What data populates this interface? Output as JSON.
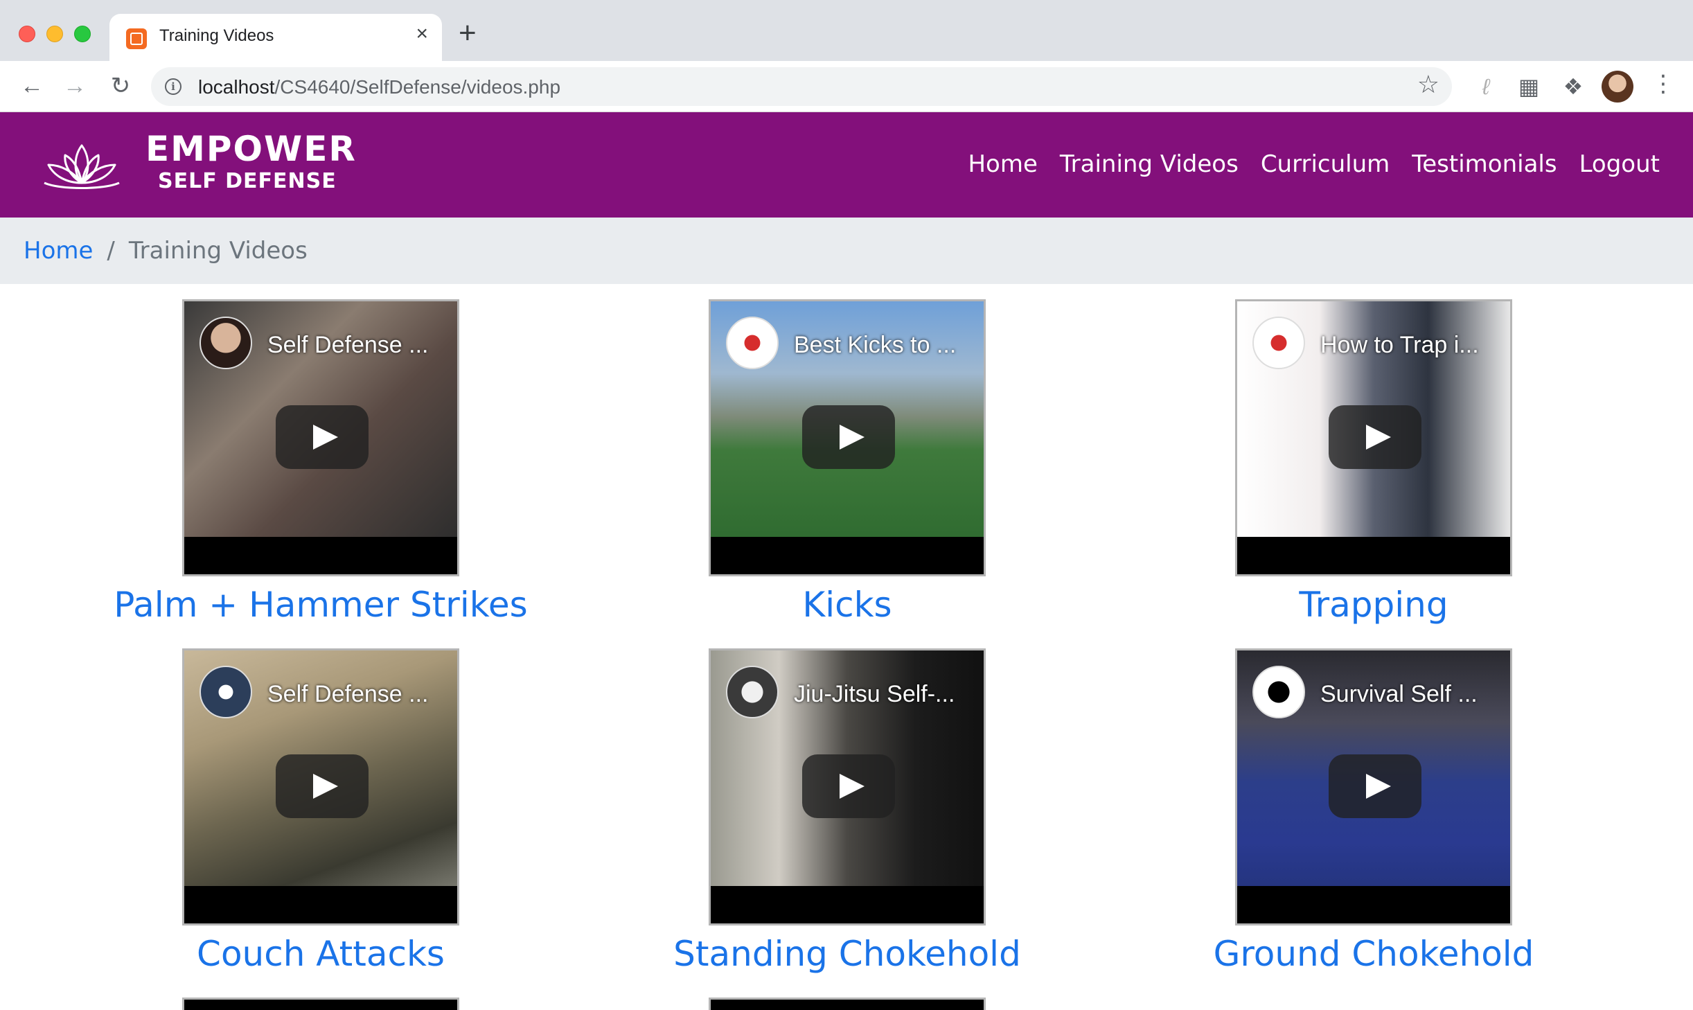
{
  "browser": {
    "tab_title": "Training Videos",
    "tab_close": "×",
    "new_tab": "+",
    "url_host": "localhost",
    "url_path": "/CS4640/SelfDefense/videos.php"
  },
  "site": {
    "brand_top": "EMPOWER",
    "brand_bottom": "SELF DEFENSE",
    "nav": [
      "Home",
      "Training Videos",
      "Curriculum",
      "Testimonials",
      "Logout"
    ],
    "colors": {
      "header": "#83107b",
      "link": "#1a73e8",
      "breadcrumb_bg": "#e9ecef"
    }
  },
  "breadcrumb": {
    "home": "Home",
    "separator": "/",
    "current": "Training Videos"
  },
  "videos": [
    {
      "overlay_title": "Self Defense ...",
      "label": "Palm + Hammer Strikes"
    },
    {
      "overlay_title": "Best Kicks to ...",
      "label": "Kicks"
    },
    {
      "overlay_title": "How to Trap i...",
      "label": "Trapping"
    },
    {
      "overlay_title": "Self Defense ...",
      "label": "Couch Attacks"
    },
    {
      "overlay_title": "Jiu-Jitsu Self-...",
      "label": "Standing Chokehold"
    },
    {
      "overlay_title": "Survival Self ...",
      "label": "Ground Chokehold"
    }
  ]
}
